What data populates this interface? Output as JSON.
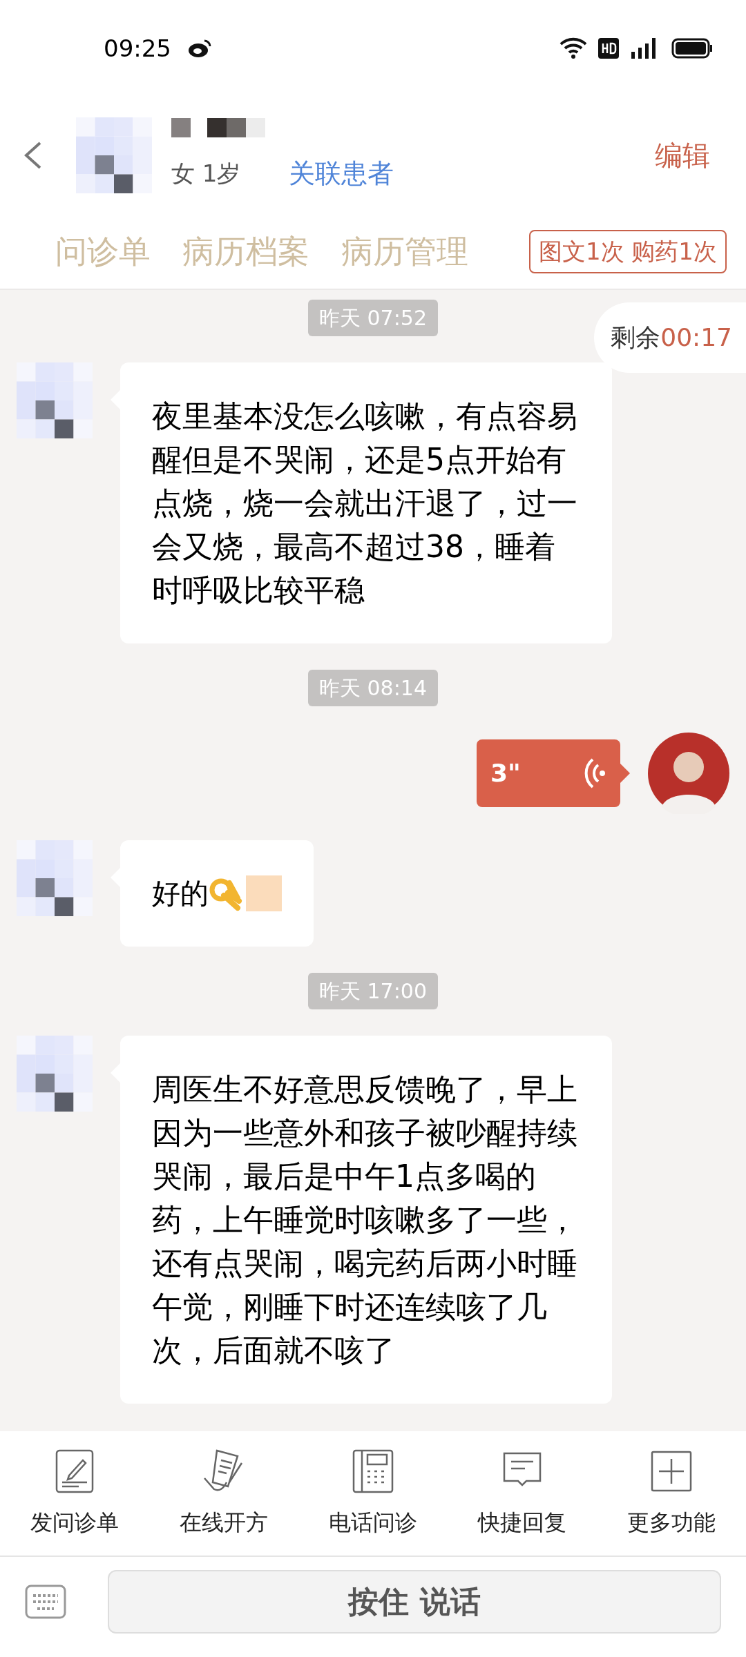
{
  "status_bar": {
    "time": "09:25"
  },
  "header": {
    "gender_age": "女 1岁",
    "link": "关联患者",
    "edit": "编辑"
  },
  "tabs": [
    {
      "label": "问诊单"
    },
    {
      "label": "病历档案"
    },
    {
      "label": "病历管理"
    }
  ],
  "service_badge": "图文1次 购药1次",
  "timer": {
    "label": "剩余",
    "value": "00:17"
  },
  "messages": [
    {
      "kind": "time",
      "text": "昨天 07:52"
    },
    {
      "kind": "text",
      "from_me": false,
      "text": "夜里基本没怎么咳嗽，有点容易醒但是不哭闹，还是5点开始有点烧，烧一会就出汗退了，过一会又烧，最高不超过38，睡着时呼吸比较平稳"
    },
    {
      "kind": "time",
      "text": "昨天 08:14"
    },
    {
      "kind": "voice",
      "from_me": true,
      "duration": "3\""
    },
    {
      "kind": "ok",
      "from_me": false,
      "text": "好的"
    },
    {
      "kind": "time",
      "text": "昨天 17:00"
    },
    {
      "kind": "text",
      "from_me": false,
      "text": "周医生不好意思反馈晚了，早上因为一些意外和孩子被吵醒持续哭闹，最后是中午1点多喝的药，上午睡觉时咳嗽多了一些，还有点哭闹，喝完药后两小时睡午觉，刚睡下时还连续咳了几次，后面就不咳了"
    }
  ],
  "tools": [
    {
      "kind": "form",
      "label": "发问诊单"
    },
    {
      "kind": "prescription",
      "label": "在线开方"
    },
    {
      "kind": "phone",
      "label": "电话问诊"
    },
    {
      "kind": "reply",
      "label": "快捷回复"
    },
    {
      "kind": "more",
      "label": "更多功能"
    }
  ],
  "input": {
    "talk_button": "按住 说话"
  }
}
